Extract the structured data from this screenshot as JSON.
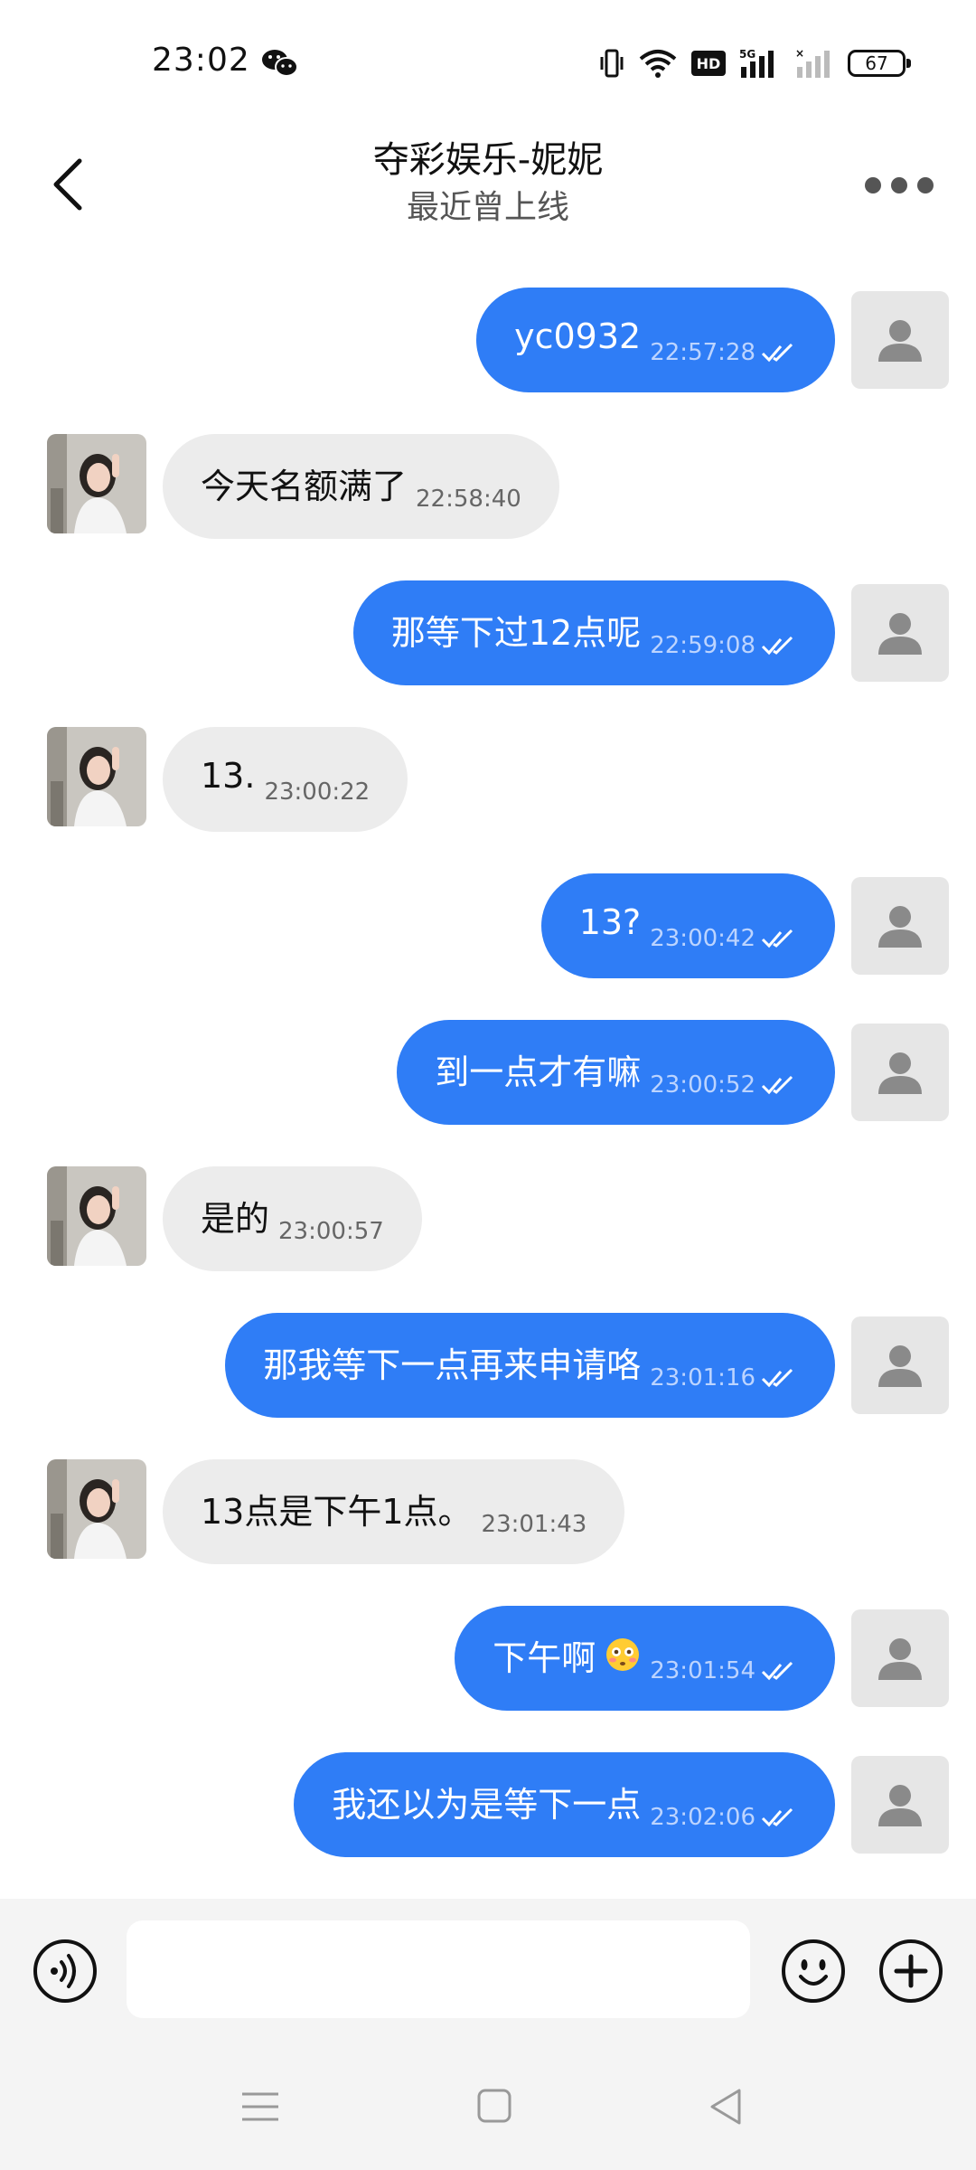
{
  "status_bar": {
    "time": "23:02",
    "battery": "67",
    "icons": [
      "wechat-icon",
      "vibrate-icon",
      "wifi-icon",
      "hd-icon",
      "signal-5g-icon",
      "signal-empty-icon",
      "battery-icon"
    ]
  },
  "header": {
    "title": "夺彩娱乐-妮妮",
    "subtitle": "最近曾上线"
  },
  "messages": [
    {
      "dir": "out",
      "text": "yc0932",
      "time": "22:57:28"
    },
    {
      "dir": "in",
      "text": "今天名额满了",
      "time": "22:58:40"
    },
    {
      "dir": "out",
      "text": "那等下过12点呢",
      "time": "22:59:08"
    },
    {
      "dir": "in",
      "text": "13.",
      "time": "23:00:22"
    },
    {
      "dir": "out",
      "text": "13?",
      "time": "23:00:42"
    },
    {
      "dir": "out",
      "text": "到一点才有嘛",
      "time": "23:00:52"
    },
    {
      "dir": "in",
      "text": "是的",
      "time": "23:00:57"
    },
    {
      "dir": "out",
      "text": "那我等下一点再来申请咯",
      "time": "23:01:16"
    },
    {
      "dir": "in",
      "text": "13点是下午1点。",
      "time": "23:01:43"
    },
    {
      "dir": "out",
      "text": "下午啊",
      "emoji": "flushed-face",
      "time": "23:01:54"
    },
    {
      "dir": "out",
      "text": "我还以为是等下一点",
      "time": "23:02:06"
    }
  ],
  "input_bar": {
    "placeholder": ""
  },
  "colors": {
    "outgoing_bubble": "#2f7df6",
    "incoming_bubble": "#ececec",
    "background": "#ffffff",
    "input_bar_bg": "#f4f4f4"
  }
}
